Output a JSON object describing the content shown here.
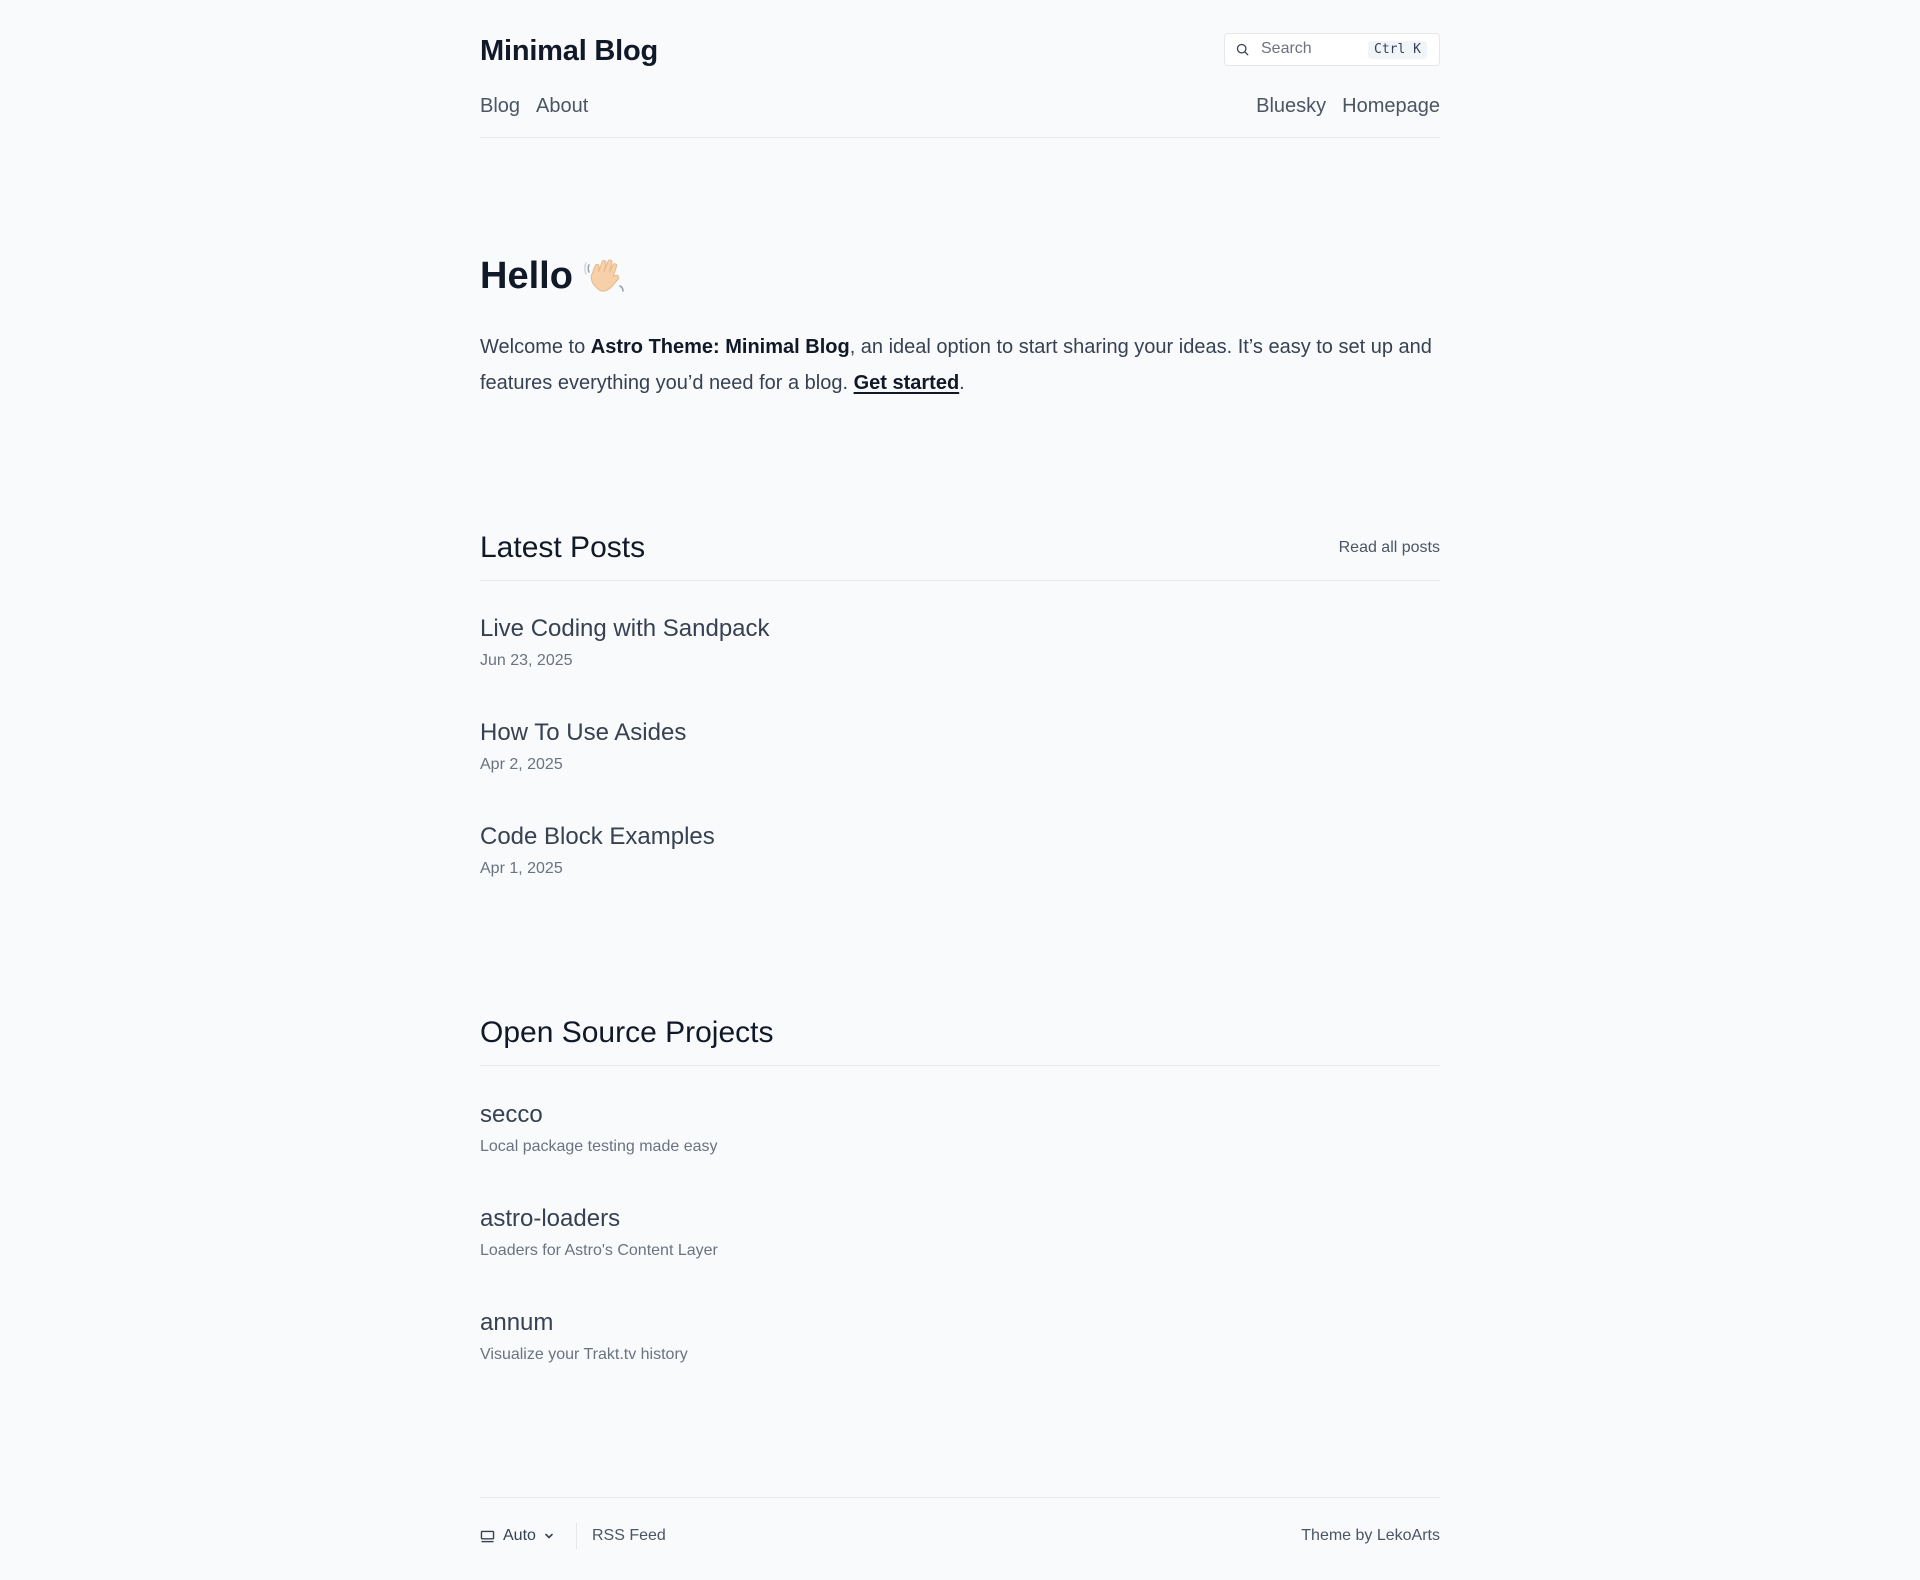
{
  "header": {
    "site_title": "Minimal Blog",
    "search": {
      "placeholder": "Search",
      "shortcut": "Ctrl K"
    },
    "nav_left": [
      "Blog",
      "About"
    ],
    "nav_right": [
      "Bluesky",
      "Homepage"
    ]
  },
  "hero": {
    "title": "Hello",
    "emoji_icon": "waving-hand-icon",
    "text_before": "Welcome to ",
    "text_bold": "Astro Theme: Minimal Blog",
    "text_after": ", an ideal option to start sharing your ideas. It’s easy to set up and features everything you’d need for a blog. ",
    "link_label": "Get started",
    "text_end": "."
  },
  "latest_posts": {
    "title": "Latest Posts",
    "read_all_label": "Read all posts",
    "items": [
      {
        "title": "Live Coding with Sandpack",
        "date": "Jun 23, 2025"
      },
      {
        "title": "How To Use Asides",
        "date": "Apr 2, 2025"
      },
      {
        "title": "Code Block Examples",
        "date": "Apr 1, 2025"
      }
    ]
  },
  "projects": {
    "title": "Open Source Projects",
    "items": [
      {
        "name": "secco",
        "description": "Local package testing made easy"
      },
      {
        "name": "astro-loaders",
        "description": "Loaders for Astro's Content Layer"
      },
      {
        "name": "annum",
        "description": "Visualize your Trakt.tv history"
      }
    ]
  },
  "footer": {
    "theme_toggle_label": "Auto",
    "rss_label": "RSS Feed",
    "credit_prefix": "Theme by ",
    "credit_link": "LekoArts"
  },
  "colors": {
    "background": "#f8fafc",
    "text": "#111827",
    "muted": "#6b7280",
    "border": "#e5e7eb"
  }
}
